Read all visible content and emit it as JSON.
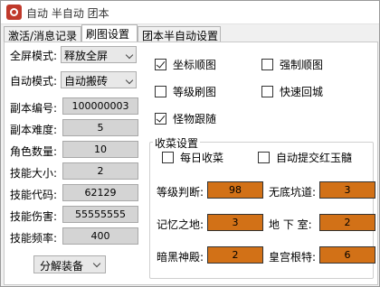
{
  "window": {
    "title": "自动 半自动 团本"
  },
  "tabs": [
    {
      "label": "激活/消息记录"
    },
    {
      "label": "刷图设置"
    },
    {
      "label": "团本半自动设置"
    }
  ],
  "left": {
    "fullscreen_label": "全屏模式:",
    "fullscreen_value": "释放全屏",
    "auto_label": "自动模式:",
    "auto_value": "自动搬砖",
    "fields": [
      {
        "label": "副本编号:",
        "value": "100000003"
      },
      {
        "label": "副本难度:",
        "value": "5"
      },
      {
        "label": "角色数量:",
        "value": "10"
      },
      {
        "label": "技能大小:",
        "value": "2"
      },
      {
        "label": "技能代码:",
        "value": "62129"
      },
      {
        "label": "技能伤害:",
        "value": "55555555"
      },
      {
        "label": "技能频率:",
        "value": "400"
      }
    ],
    "split_equip": "分解装备"
  },
  "options": {
    "coord_map": {
      "label": "坐标顺图",
      "checked": true
    },
    "force_map": {
      "label": "强制顺图",
      "checked": false
    },
    "level_map": {
      "label": "等级刷图",
      "checked": false
    },
    "quick_return": {
      "label": "快速回城",
      "checked": false
    },
    "monster_follow": {
      "label": "怪物跟随",
      "checked": true
    }
  },
  "harvest": {
    "title": "收菜设置",
    "daily": {
      "label": "每日收菜",
      "checked": false
    },
    "auto_submit": {
      "label": "自动提交红玉髓",
      "checked": false
    },
    "items": [
      {
        "label": "等级判断:",
        "value": "98"
      },
      {
        "label": "无底坑道:",
        "value": "3"
      },
      {
        "label": "记忆之地:",
        "value": "3"
      },
      {
        "label": "地 下 室:",
        "value": "2"
      },
      {
        "label": "暗黑神殿:",
        "value": "2"
      },
      {
        "label": "皇宫根特:",
        "value": "6"
      }
    ]
  }
}
